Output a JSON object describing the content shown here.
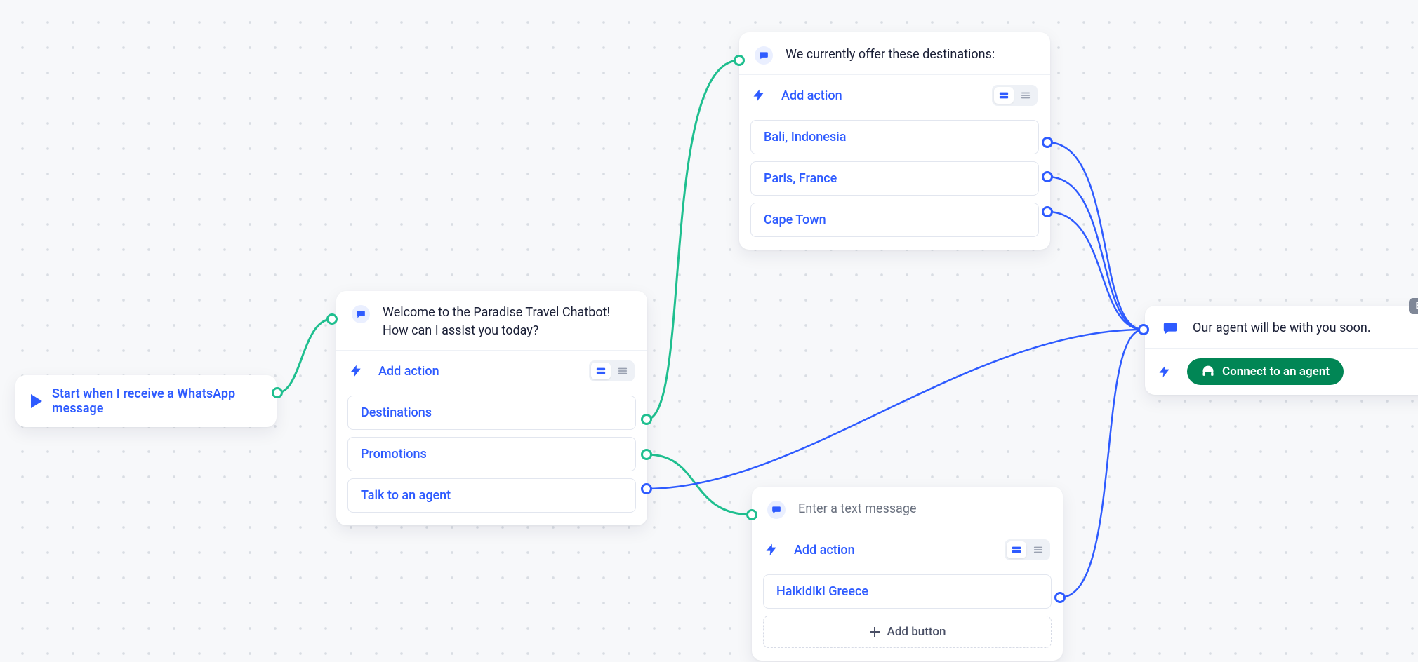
{
  "trigger": {
    "label": "Start when I receive a WhatsApp message"
  },
  "welcome": {
    "message": "Welcome to the Paradise Travel Chatbot! How can I assist you today?",
    "add_action": "Add action",
    "options": [
      "Destinations",
      "Promotions",
      "Talk to an agent"
    ]
  },
  "destinations": {
    "message": "We currently offer these destinations:",
    "add_action": "Add action",
    "options": [
      "Bali, Indonesia",
      "Paris, France",
      "Cape Town"
    ]
  },
  "promotions": {
    "message_placeholder": "Enter a text message",
    "add_action": "Add action",
    "options": [
      "Halkidiki Greece"
    ],
    "add_button_label": "Add button"
  },
  "agent": {
    "message": "Our agent will be with you soon.",
    "connect_label": "Connect to an agent",
    "end_badge": "END"
  }
}
